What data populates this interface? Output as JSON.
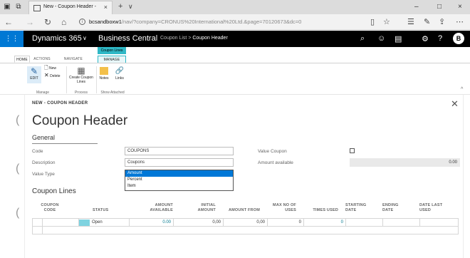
{
  "browser": {
    "tab_title": "New - Coupon Header -",
    "tab_close": "×",
    "new_tab": "+",
    "tab_dropdown": "∨",
    "url_host": "bcsandboxw1",
    "url_path": "/nav/?company=CRONUS%20International%20Ltd.&page=70120673&dc=0",
    "window_minimize": "–",
    "window_maximize": "□",
    "window_close": "×"
  },
  "appbar": {
    "product": "Dynamics 365",
    "chevron": "∨",
    "app_name": "Business Central",
    "breadcrumb_parent": "Coupon List",
    "breadcrumb_sep": ">",
    "breadcrumb_current": "Coupon Header",
    "user_initial": "B"
  },
  "ribbon": {
    "context_label": "Coupon Lines",
    "tabs": [
      "HOME",
      "ACTIONS",
      "NAVIGATE",
      "MANAGE"
    ],
    "edit": "EDIT",
    "new": "New",
    "delete": "Delete",
    "create_coupon_lines": "Create Coupon Lines",
    "notes": "Notes",
    "links": "Links",
    "groups": [
      "Manage",
      "Process",
      "Show Attached"
    ]
  },
  "page": {
    "caption": "NEW - COUPON HEADER",
    "title": "Coupon Header",
    "general_tab": "General",
    "fields": {
      "code_label": "Code",
      "code_value": "COUPONS",
      "description_label": "Description",
      "description_value": "Coupons",
      "value_type_label": "Value Type",
      "value_type_value": "Amount",
      "value_coupon_label": "Value Coupon",
      "amount_available_label": "Amount available",
      "amount_available_value": "0.00"
    },
    "value_type_options": [
      "Amount",
      "Percent",
      "Item"
    ],
    "lines_title": "Coupon Lines",
    "columns": [
      "COUPON CODE",
      "STATUS",
      "AMOUNT AVAILABLE",
      "INITIAL AMOUNT",
      "AMOUNT FROM",
      "MAX NO OF USES",
      "TIMES USED",
      "STARTING DATE",
      "ENDING DATE",
      "DATE LAST USED"
    ],
    "row": {
      "status": "Open",
      "amount_available": "0.00",
      "initial_amount": "0,00",
      "amount_from": "0,00",
      "max_uses": "0",
      "times_used": "0"
    }
  }
}
